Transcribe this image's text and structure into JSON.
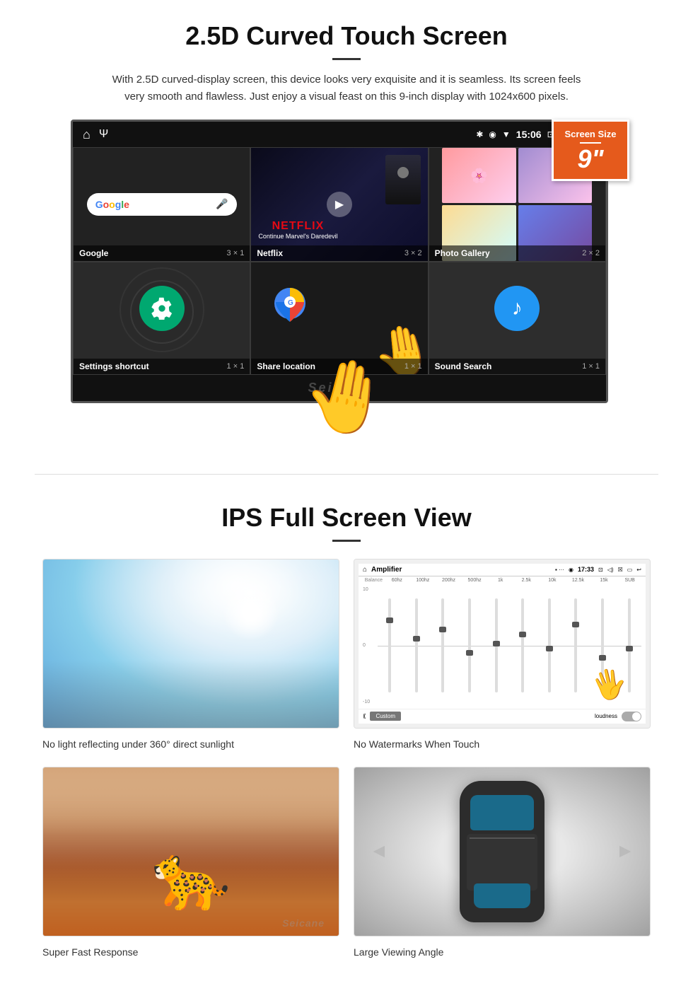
{
  "section1": {
    "title": "2.5D Curved Touch Screen",
    "description": "With 2.5D curved-display screen, this device looks very exquisite and it is seamless. Its screen feels very smooth and flawless. Just enjoy a visual feast on this 9-inch display with 1024x600 pixels.",
    "badge": {
      "label": "Screen Size",
      "size": "9\""
    },
    "statusBar": {
      "time": "15:06"
    },
    "apps": [
      {
        "name": "Google",
        "gridSize": "3 × 1"
      },
      {
        "name": "Netflix",
        "gridSize": "3 × 2"
      },
      {
        "name": "Photo Gallery",
        "gridSize": "2 × 2"
      },
      {
        "name": "Settings shortcut",
        "gridSize": "1 × 1"
      },
      {
        "name": "Share location",
        "gridSize": "1 × 1"
      },
      {
        "name": "Sound Search",
        "gridSize": "1 × 1"
      }
    ],
    "netflix": {
      "label": "NETFLIX",
      "subtitle": "Continue Marvel's Daredevil"
    },
    "watermark": "Seicane"
  },
  "section2": {
    "title": "IPS Full Screen View",
    "features": [
      {
        "id": "sunlight",
        "caption": "No light reflecting under 360° direct sunlight"
      },
      {
        "id": "watermarks",
        "caption": "No Watermarks When Touch"
      },
      {
        "id": "cheetah",
        "caption": "Super Fast Response"
      },
      {
        "id": "car",
        "caption": "Large Viewing Angle"
      }
    ],
    "seicane_watermark": "Seicane"
  }
}
